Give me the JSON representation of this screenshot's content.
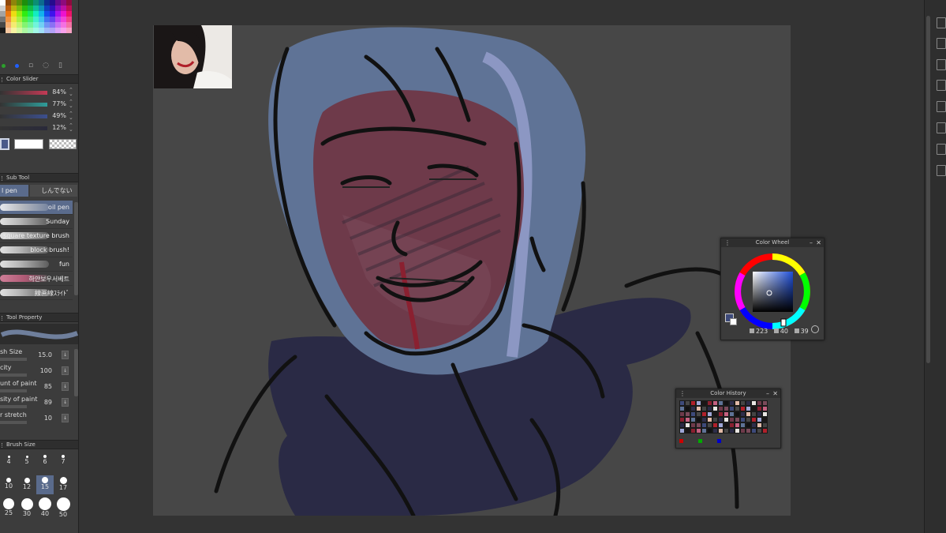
{
  "color_slider": {
    "title": "Color Slider",
    "rows": [
      {
        "value": "84%",
        "color": "#c43a55"
      },
      {
        "value": "77%",
        "color": "#2f9d9a"
      },
      {
        "value": "49%",
        "color": "#3c4f8e"
      },
      {
        "value": "12%",
        "color": "#2a2a3a"
      }
    ]
  },
  "sub_tool": {
    "title": "Sub Tool",
    "tab_active": "l pen",
    "tab_other": "しんでない",
    "brushes": [
      "oil pen",
      "Sunday",
      "square texture brush",
      "block brush!",
      "fun",
      "하얀보우서베트",
      "線画線ｽﾗｲﾄﾞ"
    ]
  },
  "tool_property": {
    "title": "Tool Property",
    "rows": [
      {
        "label": "sh Size",
        "value": "15.0"
      },
      {
        "label": "city",
        "value": "100"
      },
      {
        "label": "unt of paint",
        "value": "85"
      },
      {
        "label": "sity of paint",
        "value": "89"
      },
      {
        "label": "r stretch",
        "value": "10"
      }
    ]
  },
  "brush_size": {
    "title": "Brush Size",
    "sizes": [
      "4",
      "5",
      "6",
      "7",
      "10",
      "12",
      "15",
      "17",
      "25",
      "30",
      "40",
      "50"
    ],
    "selected": "15"
  },
  "color_wheel": {
    "title": "Color Wheel",
    "h": "223",
    "s": "40",
    "v": "39",
    "current_color": "#3d4a7a"
  },
  "color_history": {
    "title": "Color History"
  }
}
